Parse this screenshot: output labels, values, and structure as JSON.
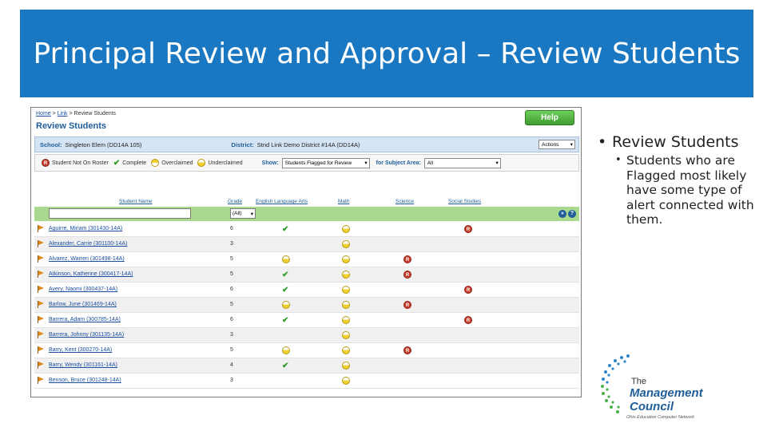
{
  "slide": {
    "title": "Principal Review and Approval – Review Students",
    "bullet_main": "Review Students",
    "bullet_sub": "Students who are Flagged most likely have some type of alert connected with them."
  },
  "app": {
    "breadcrumb": {
      "home": "Home",
      "sep1": ">",
      "link": "Link",
      "sep2": ">",
      "current": "Review Students"
    },
    "heading": "Review Students",
    "help_label": "Help",
    "school_label": "School:",
    "school_value": "Singleton Elem (DD14A 105)",
    "district_label": "District:",
    "district_value": "Stnd Link Demo District #14A (DD14A)",
    "actions_label": "Actions",
    "legend": {
      "not_on_roster": "Student Not On Roster",
      "complete": "Complete",
      "overclaimed": "Overclaimed",
      "underclaimed": "Underclaimed"
    },
    "show_label": "Show:",
    "show_value": "Students Flagged for Review",
    "subject_label": "for Subject Area:",
    "subject_value": "All",
    "columns": {
      "student_name": "Student Name",
      "grade": "Grade",
      "ela": "English Language Arts",
      "math": "Math",
      "science": "Science",
      "social": "Social Studies"
    },
    "grade_filter": "(All)",
    "rows": [
      {
        "name": "Aguirre, Miriam (301430-14A)",
        "grade": "6",
        "ela": "check",
        "math": "under",
        "science": "",
        "social": "red"
      },
      {
        "name": "Alexander, Carrie (301100-14A)",
        "grade": "3",
        "ela": "",
        "math": "under",
        "science": "",
        "social": ""
      },
      {
        "name": "Alvarez, Warren (301498-14A)",
        "grade": "5",
        "ela": "under",
        "math": "under",
        "science": "red",
        "social": ""
      },
      {
        "name": "Atkinson, Katherine (300417-14A)",
        "grade": "5",
        "ela": "check",
        "math": "under",
        "science": "red",
        "social": ""
      },
      {
        "name": "Avery, Naomi (300437-14A)",
        "grade": "6",
        "ela": "check",
        "math": "under",
        "science": "",
        "social": "red"
      },
      {
        "name": "Barlow, June (301469-14A)",
        "grade": "5",
        "ela": "under",
        "math": "under",
        "science": "red",
        "social": ""
      },
      {
        "name": "Barrera, Adam (300785-14A)",
        "grade": "6",
        "ela": "check",
        "math": "under",
        "science": "",
        "social": "red"
      },
      {
        "name": "Barrera, Johnny (301135-14A)",
        "grade": "3",
        "ela": "",
        "math": "under",
        "science": "",
        "social": ""
      },
      {
        "name": "Barry, Kent (300270-14A)",
        "grade": "5",
        "ela": "under",
        "math": "under",
        "science": "red",
        "social": ""
      },
      {
        "name": "Barry, Wendy (301161-14A)",
        "grade": "4",
        "ela": "check",
        "math": "under",
        "science": "",
        "social": ""
      },
      {
        "name": "Benson, Bruce (301248-14A)",
        "grade": "3",
        "ela": "",
        "math": "under",
        "science": "",
        "social": ""
      }
    ]
  },
  "logo": {
    "the": "The",
    "line1": "Management",
    "line2": "Council",
    "tagline": "Ohio Education Computer Network"
  },
  "colors": {
    "title_bg": "#1a78c2",
    "filter_row": "#a9d98c",
    "school_bar": "#d4e4f4",
    "help": "#4fb33d"
  }
}
